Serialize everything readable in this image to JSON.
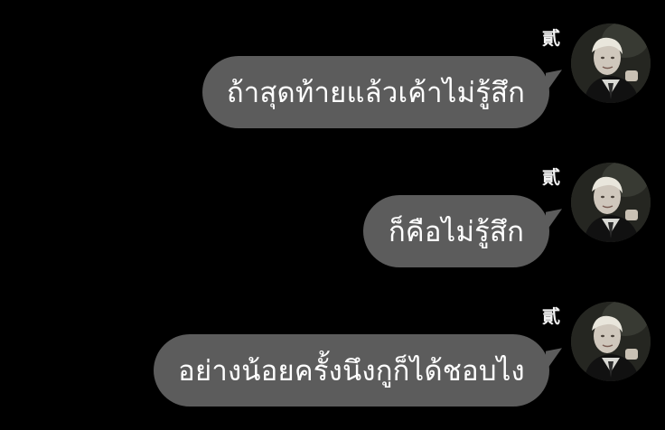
{
  "messages": [
    {
      "sender": "貳",
      "text": "ถ้าสุดท้ายแล้วเค้าไม่รู้สึก",
      "avatar_icon": "user-avatar-photo-icon"
    },
    {
      "sender": "貳",
      "text": "ก็คือไม่รู้สึก",
      "avatar_icon": "user-avatar-photo-icon"
    },
    {
      "sender": "貳",
      "text": "อย่างน้อยครั้งนึงกูก็ได้ชอบไง",
      "avatar_icon": "user-avatar-photo-icon"
    }
  ],
  "colors": {
    "background": "#000000",
    "bubble": "#5c5c5c",
    "text": "#ffffff",
    "sender": "#f2f2f2"
  }
}
